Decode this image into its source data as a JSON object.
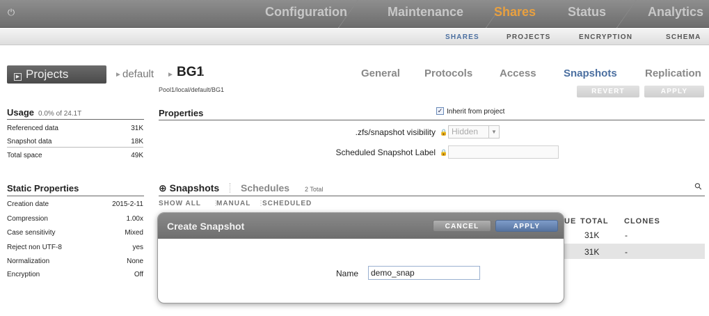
{
  "topnav": {
    "tabs": [
      {
        "label": "Configuration"
      },
      {
        "label": "Maintenance"
      },
      {
        "label": "Shares",
        "active": true
      },
      {
        "label": "Status"
      },
      {
        "label": "Analytics"
      }
    ],
    "active_color": "#e8a040"
  },
  "subnav": {
    "items": [
      {
        "label": "SHARES",
        "active": true
      },
      {
        "label": "PROJECTS"
      },
      {
        "label": "ENCRYPTION"
      },
      {
        "label": "SCHEMA"
      }
    ]
  },
  "header": {
    "projects_label": "Projects",
    "crumb_parent": "default",
    "share_name": "BG1",
    "path": "Pool1/local/default/BG1",
    "tabs": [
      {
        "label": "General"
      },
      {
        "label": "Protocols"
      },
      {
        "label": "Access"
      },
      {
        "label": "Snapshots",
        "active": true
      },
      {
        "label": "Replication"
      }
    ],
    "revert_label": "REVERT",
    "apply_label": "APPLY"
  },
  "usage": {
    "title": "Usage",
    "summary": "0.0% of 24.1T",
    "rows": [
      {
        "label": "Referenced data",
        "value": "31K"
      },
      {
        "label": "Snapshot data",
        "value": "18K"
      },
      {
        "label": "Total space",
        "value": "49K"
      }
    ]
  },
  "static_properties": {
    "title": "Static Properties",
    "rows": [
      {
        "label": "Creation date",
        "value": "2015-2-11"
      },
      {
        "label": "Compression",
        "value": "1.00x"
      },
      {
        "label": "Case sensitivity",
        "value": "Mixed"
      },
      {
        "label": "Reject non UTF-8",
        "value": "yes"
      },
      {
        "label": "Normalization",
        "value": "None"
      },
      {
        "label": "Encryption",
        "value": "Off"
      }
    ]
  },
  "properties": {
    "title": "Properties",
    "inherit_label": "Inherit from project",
    "inherit_checked": true,
    "visibility_label": ".zfs/snapshot visibility",
    "visibility_value": "Hidden",
    "scheduled_label": "Scheduled Snapshot Label",
    "scheduled_value": ""
  },
  "snapshots": {
    "title": "Snapshots",
    "schedules_label": "Schedules",
    "total": "2 Total",
    "filters": [
      "SHOW ALL",
      "MANUAL",
      "SCHEDULED"
    ],
    "columns": [
      "UE",
      "TOTAL",
      "CLONES"
    ],
    "rows": [
      {
        "total": "31K",
        "clones": "-"
      },
      {
        "total": "31K",
        "clones": "-"
      }
    ]
  },
  "dialog": {
    "title": "Create Snapshot",
    "cancel_label": "CANCEL",
    "apply_label": "APPLY",
    "name_label": "Name",
    "name_value": "demo_snap"
  }
}
